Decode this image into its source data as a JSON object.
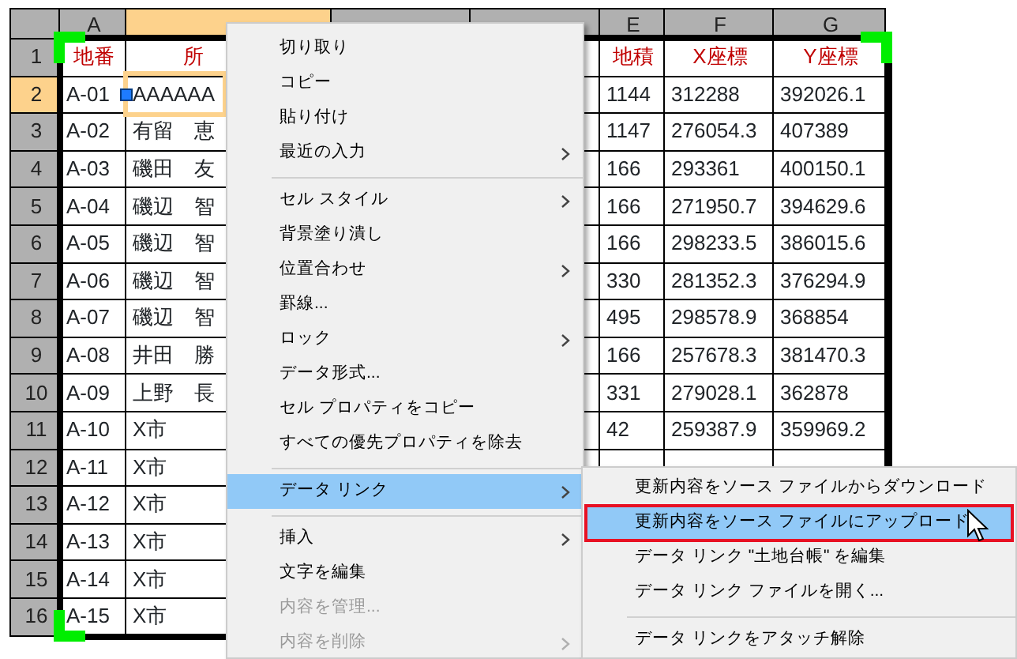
{
  "sheet": {
    "columns": [
      {
        "label": "A",
        "selected": false
      },
      {
        "selected": true
      },
      {
        "selected": false
      },
      {
        "selected": false
      },
      {
        "label": "E",
        "selected": false
      },
      {
        "label": "F",
        "selected": false
      },
      {
        "label": "G",
        "selected": false
      }
    ],
    "rows": [
      {
        "label": "1",
        "selected": false,
        "kind": "header",
        "cells": {
          "a": "地番",
          "b": "所",
          "e": "地積",
          "f": "X座標",
          "g": "Y座標"
        }
      },
      {
        "label": "2",
        "selected": true,
        "kind": "data",
        "cells": {
          "a": "A-01",
          "b": "AAAAAA",
          "e": "1144",
          "f": "312288",
          "g": "392026.1"
        }
      },
      {
        "label": "3",
        "selected": false,
        "kind": "data",
        "cells": {
          "a": "A-02",
          "b": "有留　恵",
          "e": "1147",
          "f": "276054.3",
          "g": "407389"
        }
      },
      {
        "label": "4",
        "selected": false,
        "kind": "data",
        "cells": {
          "a": "A-03",
          "b": "磯田　友",
          "e": "166",
          "f": "293361",
          "g": "400150.1"
        }
      },
      {
        "label": "5",
        "selected": false,
        "kind": "data",
        "cells": {
          "a": "A-04",
          "b": "磯辺　智",
          "e": "166",
          "f": "271950.7",
          "g": "394629.6"
        }
      },
      {
        "label": "6",
        "selected": false,
        "kind": "data",
        "cells": {
          "a": "A-05",
          "b": "磯辺　智",
          "e": "166",
          "f": "298233.5",
          "g": "386015.6"
        }
      },
      {
        "label": "7",
        "selected": false,
        "kind": "data",
        "cells": {
          "a": "A-06",
          "b": "磯辺　智",
          "e": "330",
          "f": "281352.3",
          "g": "376294.9"
        }
      },
      {
        "label": "8",
        "selected": false,
        "kind": "data",
        "cells": {
          "a": "A-07",
          "b": "磯辺　智",
          "e": "495",
          "f": "298578.9",
          "g": "368854"
        }
      },
      {
        "label": "9",
        "selected": false,
        "kind": "data",
        "cells": {
          "a": "A-08",
          "b": "井田　勝",
          "e": "166",
          "f": "257678.3",
          "g": "381470.3"
        }
      },
      {
        "label": "10",
        "selected": false,
        "kind": "data",
        "cells": {
          "a": "A-09",
          "b": "上野　長",
          "e": "331",
          "f": "279028.1",
          "g": "362878"
        }
      },
      {
        "label": "11",
        "selected": false,
        "kind": "data",
        "cells": {
          "a": "A-10",
          "b": "X市",
          "e": "42",
          "f": "259387.9",
          "g": "359969.2"
        }
      },
      {
        "label": "12",
        "selected": false,
        "kind": "data",
        "cells": {
          "a": "A-11",
          "b": "X市"
        }
      },
      {
        "label": "13",
        "selected": false,
        "kind": "data",
        "cells": {
          "a": "A-12",
          "b": "X市"
        }
      },
      {
        "label": "14",
        "selected": false,
        "kind": "data",
        "cells": {
          "a": "A-13",
          "b": "X市"
        }
      },
      {
        "label": "15",
        "selected": false,
        "kind": "data",
        "cells": {
          "a": "A-14",
          "b": "X市"
        }
      },
      {
        "label": "16",
        "selected": false,
        "kind": "data",
        "cells": {
          "a": "A-15",
          "b": "X市"
        }
      }
    ]
  },
  "context_menu": {
    "items": [
      {
        "kind": "item",
        "label": "切り取り",
        "submenu": false,
        "disabled": false,
        "selected": false
      },
      {
        "kind": "item",
        "label": "コピー",
        "submenu": false,
        "disabled": false,
        "selected": false
      },
      {
        "kind": "item",
        "label": "貼り付け",
        "submenu": false,
        "disabled": false,
        "selected": false
      },
      {
        "kind": "item",
        "label": "最近の入力",
        "submenu": true,
        "disabled": false,
        "selected": false
      },
      {
        "kind": "separator"
      },
      {
        "kind": "item",
        "label": "セル スタイル",
        "submenu": true,
        "disabled": false,
        "selected": false
      },
      {
        "kind": "item",
        "label": "背景塗り潰し",
        "submenu": false,
        "disabled": false,
        "selected": false
      },
      {
        "kind": "item",
        "label": "位置合わせ",
        "submenu": true,
        "disabled": false,
        "selected": false
      },
      {
        "kind": "item",
        "label": "罫線...",
        "submenu": false,
        "disabled": false,
        "selected": false
      },
      {
        "kind": "item",
        "label": "ロック",
        "submenu": true,
        "disabled": false,
        "selected": false
      },
      {
        "kind": "item",
        "label": "データ形式...",
        "submenu": false,
        "disabled": false,
        "selected": false
      },
      {
        "kind": "item",
        "label": "セル プロパティをコピー",
        "submenu": false,
        "disabled": false,
        "selected": false
      },
      {
        "kind": "item",
        "label": "すべての優先プロパティを除去",
        "submenu": false,
        "disabled": false,
        "selected": false
      },
      {
        "kind": "separator"
      },
      {
        "kind": "item",
        "label": "データ リンク",
        "submenu": true,
        "disabled": false,
        "selected": true
      },
      {
        "kind": "separator"
      },
      {
        "kind": "item",
        "label": "挿入",
        "submenu": true,
        "disabled": false,
        "selected": false
      },
      {
        "kind": "item",
        "label": "文字を編集",
        "submenu": false,
        "disabled": false,
        "selected": false
      },
      {
        "kind": "item",
        "label": "内容を管理...",
        "submenu": false,
        "disabled": true,
        "selected": false
      },
      {
        "kind": "item",
        "label": "内容を削除",
        "submenu": true,
        "disabled": true,
        "selected": false
      }
    ]
  },
  "submenu": {
    "items": [
      {
        "kind": "item",
        "label": "更新内容をソース ファイルからダウンロード",
        "selected": false,
        "outlined": false
      },
      {
        "kind": "item",
        "label": "更新内容をソース ファイルにアップロード",
        "selected": true,
        "outlined": true
      },
      {
        "kind": "item",
        "label": "データ リンク \"土地台帳\" を編集",
        "selected": false,
        "outlined": false
      },
      {
        "kind": "item",
        "label": "データ リンク ファイルを開く...",
        "selected": false,
        "outlined": false
      },
      {
        "kind": "separator"
      },
      {
        "kind": "item",
        "label": "データ リンクをアタッチ解除",
        "selected": false,
        "outlined": false
      }
    ]
  }
}
